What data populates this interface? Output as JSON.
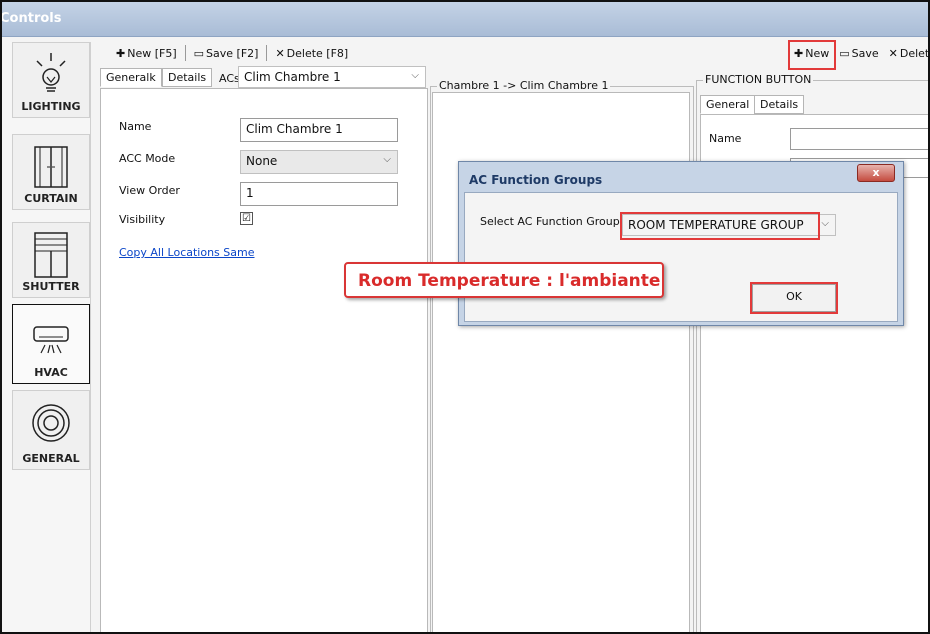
{
  "window": {
    "title": "Controls"
  },
  "nav": [
    {
      "label": "LIGHTING",
      "icon": "light-bulb-icon"
    },
    {
      "label": "CURTAIN",
      "icon": "curtain-icon"
    },
    {
      "label": "SHUTTER",
      "icon": "shutter-icon"
    },
    {
      "label": "HVAC",
      "icon": "air-conditioner-icon"
    },
    {
      "label": "GENERAL",
      "icon": "target-icon"
    }
  ],
  "toolbar_left": {
    "new": "New [F5]",
    "save": "Save [F2]",
    "delete": "Delete [F8]"
  },
  "toolbar_right": {
    "new": "New",
    "save": "Save",
    "delete": "Delete"
  },
  "left_panel": {
    "tabs": [
      "Generalk",
      "Details"
    ],
    "acs_label": "ACs",
    "acs_value": "Clim Chambre 1",
    "fields": {
      "name_label": "Name",
      "name_value": "Clim Chambre 1",
      "acc_label": "ACC Mode",
      "acc_value": "None",
      "order_label": "View Order",
      "order_value": "1",
      "visibility_label": "Visibility",
      "visibility_checked": "☑"
    },
    "copy_link": "Copy All Locations Same"
  },
  "middle_panel": {
    "title": "Chambre 1 -> Clim Chambre 1"
  },
  "right_panel": {
    "title": "FUNCTION BUTTON",
    "tabs": [
      "General",
      "Details"
    ],
    "name_label": "Name"
  },
  "dialog": {
    "title": "AC Function Groups",
    "close": "x",
    "select_label": "Select AC Function Group",
    "select_value": "ROOM TEMPERATURE GROUP",
    "ok": "OK"
  },
  "annotation": {
    "text": "Room Temperature : l'ambiante",
    "color": "#d92b2b"
  }
}
